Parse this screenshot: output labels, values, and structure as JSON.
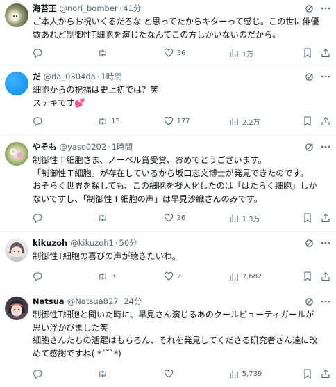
{
  "replies": [
    {
      "name": "海苔王",
      "handle": "@nori_bomber",
      "time": "41分",
      "lines": [
        "ご本人からお祝いくるだろな と思ってたからキターって感じ。この世に俳優",
        "数あれど制御性T細胞を演じたなんてこの方しかいないのだから。"
      ],
      "replies": "",
      "reposts": "",
      "likes": "36",
      "views": "1万",
      "avatar": "avatar-photo"
    },
    {
      "name": "だ",
      "handle": "@da_0304da",
      "time": "1時間",
      "lines": [
        "細胞からの祝福は史上初では？笑",
        "ステキです💕"
      ],
      "replies": "",
      "reposts": "15",
      "likes": "177",
      "views": "2.2万",
      "avatar": "avatar-blue-circle"
    },
    {
      "name": "やそも",
      "handle": "@yaso0202",
      "time": "1時間",
      "lines": [
        "制御性Ｔ細胞さま、ノーベル賞受賞、おめでとうございます。",
        "「制御性Ｔ細胞」が存在しているから坂口志文博士が発見できたのです。",
        "おそらく世界を探しても、この細胞を擬人化したのは「はたらく細胞」しか",
        "ないですし、「制御性Ｔ細胞の声」は早見沙織さんのみです。"
      ],
      "replies": "",
      "reposts": "",
      "likes": "26",
      "views": "1.3万",
      "avatar": "avatar-flowers"
    },
    {
      "name": "kikuzoh",
      "handle": "@kikuzoh1",
      "time": "50分",
      "lines": [
        "制御性T細胞の喜びの声が聴きたいわ。"
      ],
      "replies": "",
      "reposts": "3",
      "likes": "2",
      "views": "7,682",
      "avatar": "avatar-anime"
    },
    {
      "name": "Natsua",
      "handle": "@Natsua827",
      "time": "24分",
      "lines": [
        "制御性T細胞と聞いた時に、早見さん演じるあのクールビューティガールが",
        "思い浮かびました笑",
        "細胞さんたちの活躍はもちろん、それを発見してくださる研究者さん達に改",
        "めて感謝ですね( *´˘`*)"
      ],
      "replies": "",
      "reposts": "",
      "likes": "",
      "views": "5,739",
      "avatar": "avatar-anime"
    }
  ],
  "separator": "·",
  "colors": {
    "muted": "#536471",
    "text": "#0f1419",
    "divider": "#eff3f4",
    "blue_avatar": "#1d9bf0"
  }
}
